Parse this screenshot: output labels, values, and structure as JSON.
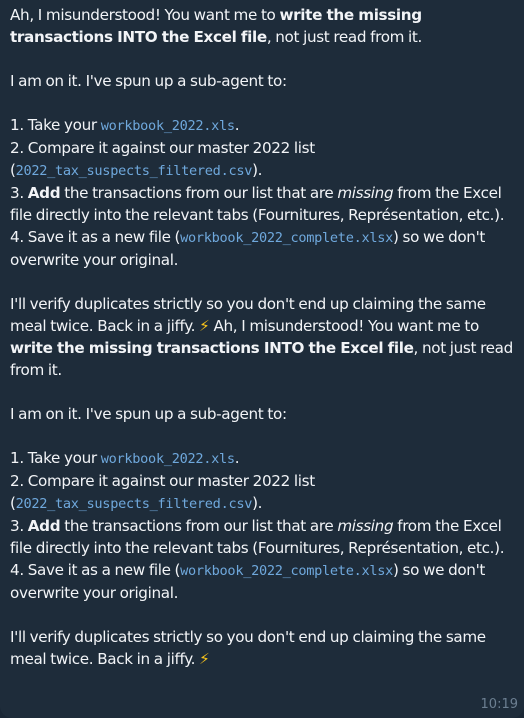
{
  "message": {
    "part1": {
      "p1": {
        "a": "Ah, I misunderstood! You want me to ",
        "b": "write the missing transactions INTO the Excel file",
        "c": ", not just read from it."
      },
      "p2": "I am on it. I've spun up a sub-agent to:",
      "step1": {
        "a": "1. Take your ",
        "code": "workbook_2022.xls",
        "b": "."
      },
      "step2": {
        "a": "2. Compare it against our master 2022 list",
        "b": "(",
        "code": "2022_tax_suspects_filtered.csv",
        "c": ")."
      },
      "step3": {
        "num": "3. ",
        "bold": "Add",
        "a": " the transactions from our list that are ",
        "italic": "missing",
        "b": " from the Excel file directly into the relevant tabs (Fournitures, Représentation, etc.)."
      },
      "step4": {
        "a": "4. Save it as a new file (",
        "code": "workbook_2022_complete.xlsx",
        "b": ") so we don't overwrite your original."
      },
      "p_last": "I'll verify duplicates strictly so you don't end up claiming the same meal twice. Back in a jiffy. "
    },
    "part2": {
      "p1": {
        "a": " Ah, I misunderstood! You want me to ",
        "b": "write the missing transactions INTO the Excel file",
        "c": ", not just read from it."
      },
      "p2": "I am on it. I've spun up a sub-agent to:",
      "step1": {
        "a": "1. Take your ",
        "code": "workbook_2022.xls",
        "b": "."
      },
      "step2": {
        "a": "2. Compare it against our master 2022 list",
        "b": "(",
        "code": "2022_tax_suspects_filtered.csv",
        "c": ")."
      },
      "step3": {
        "num": "3. ",
        "bold": "Add",
        "a": " the transactions from our list that are ",
        "italic": "missing",
        "b": " from the Excel file directly into the relevant tabs (Fournitures, Représentation, etc.)."
      },
      "step4": {
        "a": "4. Save it as a new file (",
        "code": "workbook_2022_complete.xlsx",
        "b": ") so we don't overwrite your original."
      },
      "p_last": "I'll verify duplicates strictly so you don't end up claiming the same meal twice. Back in a jiffy. "
    },
    "emoji": "⚡",
    "time": "10:19"
  },
  "colors": {
    "bubble_bg": "#1e2c3a",
    "text": "#f2f4f7",
    "code": "#6fa8dc",
    "timestamp": "#6c7f91"
  }
}
